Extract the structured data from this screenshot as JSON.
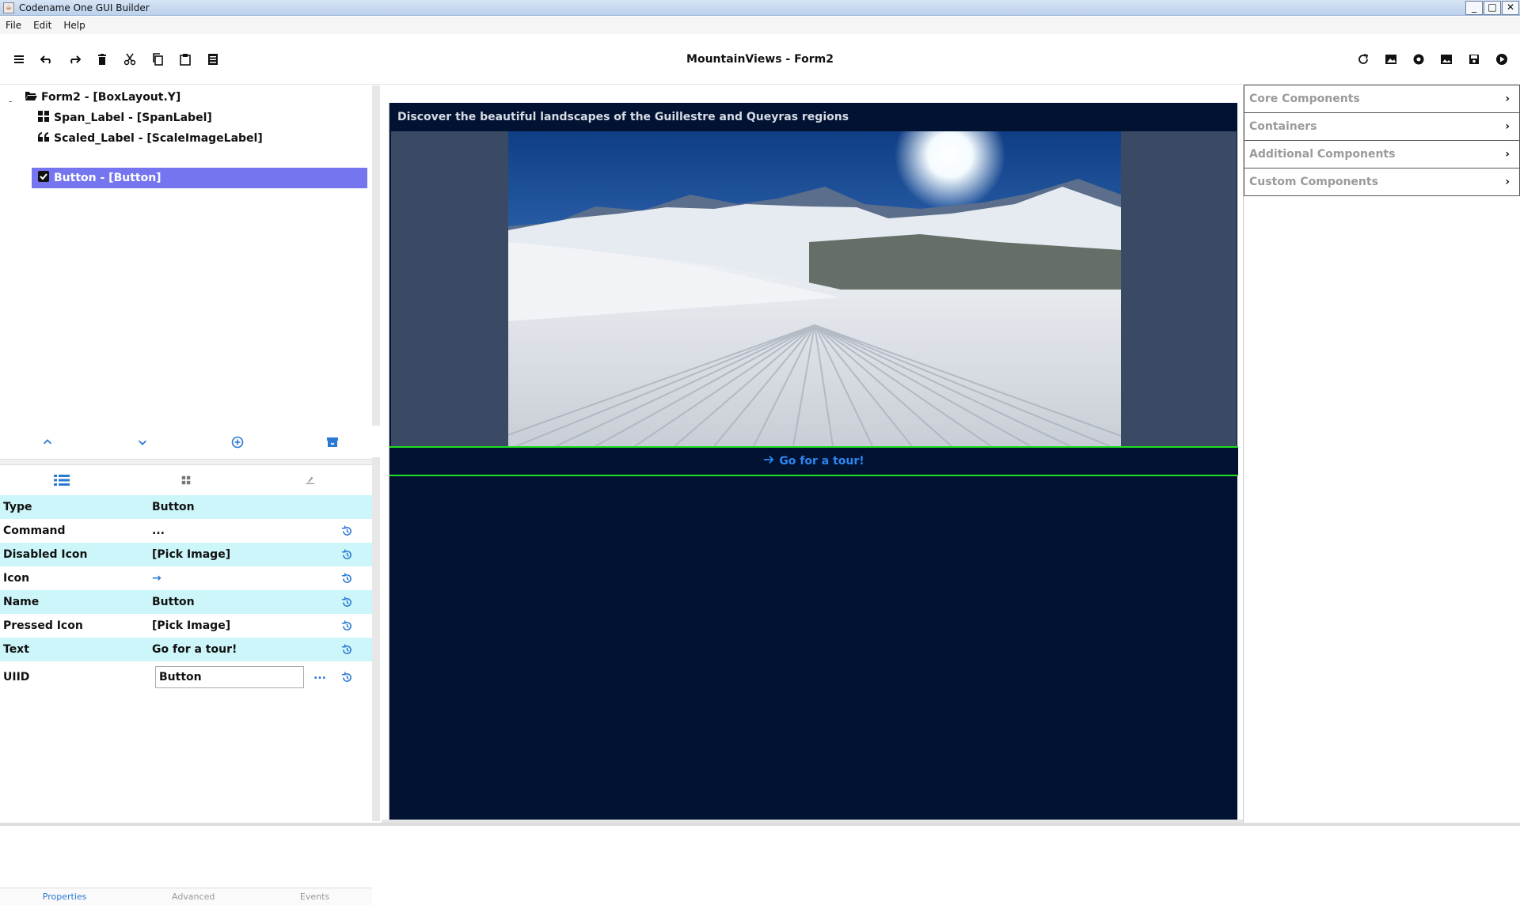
{
  "window": {
    "title": "Codename One GUI Builder",
    "minimize": "_",
    "maximize": "□",
    "close": "✕"
  },
  "menu": [
    "File",
    "Edit",
    "Help"
  ],
  "toolbar": {
    "doc_title": "MountainViews - Form2"
  },
  "tree": {
    "toggle": "-",
    "items": [
      {
        "label": "Form2 - [BoxLayout.Y]",
        "icon": "folder-open-icon"
      },
      {
        "label": "Span_Label - [SpanLabel]",
        "icon": "grid-icon"
      },
      {
        "label": "Scaled_Label - [ScaleImageLabel]",
        "icon": "quote-icon"
      },
      {
        "label": "Button - [Button]",
        "icon": "checkbox-icon",
        "selected": true
      }
    ]
  },
  "properties": {
    "rows": [
      {
        "name": "Type",
        "value": "Button"
      },
      {
        "name": "Command",
        "value": "..."
      },
      {
        "name": "Disabled Icon",
        "value": "[Pick Image]"
      },
      {
        "name": "Icon",
        "value": "→"
      },
      {
        "name": "Name",
        "value": "Button"
      },
      {
        "name": "Pressed Icon",
        "value": "[Pick Image]"
      },
      {
        "name": "Text",
        "value": "Go for a tour!"
      }
    ],
    "uiid": {
      "name": "UIID",
      "value": "Button",
      "more": "..."
    }
  },
  "bottom_tabs": [
    "Properties",
    "Advanced",
    "Events"
  ],
  "canvas": {
    "form_title": "Discover the beautiful landscapes of the Guillestre and Queyras regions",
    "button_text": "Go for a tour!"
  },
  "palette": [
    "Core Components",
    "Containers",
    "Additional Components",
    "Custom Components"
  ],
  "colors": {
    "selection": "#7575f0",
    "prop_alt_row": "#ccf6f9",
    "form_bg": "#011233",
    "accent": "#2a78d2",
    "button_border": "#1fe01f"
  }
}
